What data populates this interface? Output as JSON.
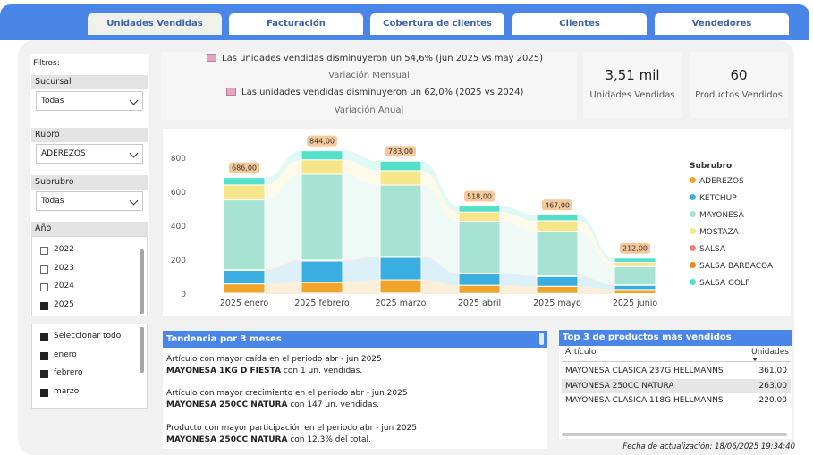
{
  "tabs": [
    {
      "label": "Unidades Vendidas",
      "active": true
    },
    {
      "label": "Facturación",
      "active": false
    },
    {
      "label": "Cobertura de clientes",
      "active": false
    },
    {
      "label": "Clientes",
      "active": false
    },
    {
      "label": "Vendedores",
      "active": false
    }
  ],
  "filters": {
    "title": "Filtros:",
    "sucursal": {
      "label": "Sucursal",
      "value": "Todas"
    },
    "rubro": {
      "label": "Rubro",
      "value": "ADEREZOS"
    },
    "subrubro": {
      "label": "Subrubro",
      "value": "Todas"
    },
    "anio": {
      "label": "Año",
      "options": [
        {
          "label": "2022",
          "checked": false
        },
        {
          "label": "2023",
          "checked": false
        },
        {
          "label": "2024",
          "checked": false
        },
        {
          "label": "2025",
          "checked": true
        }
      ]
    },
    "meses": {
      "options": [
        {
          "label": "Seleccionar todo",
          "checked": true
        },
        {
          "label": "enero",
          "checked": true
        },
        {
          "label": "febrero",
          "checked": true
        },
        {
          "label": "marzo",
          "checked": true
        }
      ]
    }
  },
  "kpis": {
    "mensual_text": "Las unidades vendidas disminuyeron un 54,6% (jun 2025 vs may 2025)",
    "mensual_label": "Variación Mensual",
    "anual_text": "Las unidades vendidas disminuyeron un 62,0% (2025 vs 2024)",
    "anual_label": "Variación Anual",
    "unidades_value": "3,51 mil",
    "unidades_label": "Unidades Vendidas",
    "productos_value": "60",
    "productos_label": "Productos Vendidos"
  },
  "chart_data": {
    "type": "bar",
    "stacked": true,
    "categories": [
      "2025 enero",
      "2025 febrero",
      "2025 marzo",
      "2025 abril",
      "2025 mayo",
      "2025 junio"
    ],
    "totals": [
      686,
      844,
      783,
      518,
      467,
      212
    ],
    "total_labels": [
      "686,00",
      "844,00",
      "783,00",
      "518,00",
      "467,00",
      "212,00"
    ],
    "ylim": [
      0,
      900
    ],
    "yticks": [
      0,
      200,
      400,
      600,
      800
    ],
    "legend_title": "Subrubro",
    "series": [
      {
        "name": "SALSA BARBACOA",
        "color": "#e8891a",
        "values": [
          5,
          6,
          6,
          4,
          4,
          2
        ]
      },
      {
        "name": "ADEREZOS",
        "color": "#f0a52a",
        "values": [
          55,
          62,
          78,
          48,
          42,
          25
        ]
      },
      {
        "name": "KETCHUP",
        "color": "#3aaee0",
        "values": [
          80,
          127,
          132,
          68,
          58,
          25
        ]
      },
      {
        "name": "SALSA",
        "color": "#f08080",
        "values": [
          5,
          6,
          6,
          4,
          4,
          2
        ]
      },
      {
        "name": "MAYONESA",
        "color": "#a6e3d2",
        "values": [
          410,
          505,
          420,
          305,
          262,
          108
        ]
      },
      {
        "name": "MOSTAZA",
        "color": "#f7e58a",
        "values": [
          88,
          85,
          85,
          54,
          62,
          25
        ]
      },
      {
        "name": "SALSA GOLF",
        "color": "#52e0c8",
        "values": [
          43,
          53,
          56,
          35,
          35,
          25
        ]
      }
    ],
    "legend_order": [
      "ADEREZOS",
      "KETCHUP",
      "MAYONESA",
      "MOSTAZA",
      "SALSA",
      "SALSA BARBACOA",
      "SALSA GOLF"
    ],
    "legend_colors": [
      "#f0a52a",
      "#3aaee0",
      "#a6e3d2",
      "#f7e58a",
      "#f08080",
      "#e8891a",
      "#52e0c8"
    ]
  },
  "tendencia": {
    "title": "Tendencia por 3 meses",
    "items": [
      {
        "l1": "Artículo con mayor caída en el periodo abr - jun 2025",
        "name": "MAYONESA 1KG D FIESTA",
        "rest": " con 1 un. vendidas."
      },
      {
        "l1": "Artículo con mayor crecimiento en el periodo abr - jun 2025",
        "name": "MAYONESA 250CC NATURA",
        "rest": " con 147 un. vendidas."
      },
      {
        "l1": "Producto con mayor participación en el periodo abr - jun 2025",
        "name": "MAYONESA 250CC NATURA",
        "rest": " con 12,3% del total."
      }
    ]
  },
  "top3": {
    "title": "Top 3 de productos más vendidos",
    "col_articulo": "Artículo",
    "col_unidades": "Unidades",
    "rows": [
      {
        "name": "MAYONESA CLASICA 237G HELLMANNS",
        "value": "361,00"
      },
      {
        "name": "MAYONESA 250CC NATURA",
        "value": "263,00"
      },
      {
        "name": "MAYONESA CLASICA 118G HELLMANNS",
        "value": "220,00"
      }
    ]
  },
  "update": "Fecha de actualización: 18/06/2025 19:34:40"
}
